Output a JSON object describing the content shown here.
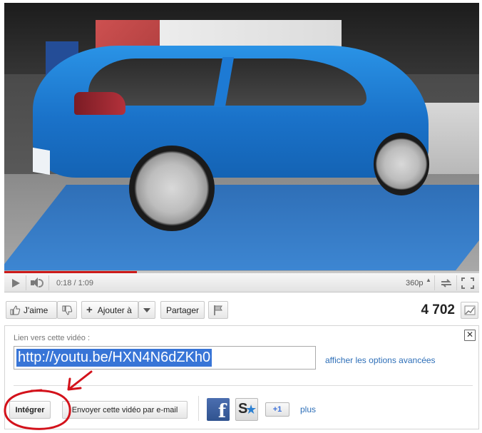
{
  "player": {
    "time_label": "0:18 / 1:09",
    "quality_label": "360p",
    "progress_fraction": 0.28
  },
  "actions": {
    "like_label": "J'aime",
    "add_label": "Ajouter à",
    "share_label": "Partager",
    "view_count": "4 702"
  },
  "share": {
    "link_title": "Lien vers cette vidéo :",
    "url": "http://youtu.be/HXN4N6dZKh0",
    "advanced_link": "afficher les options avancées",
    "close_label": "✕",
    "embed_label": "Intégrer",
    "email_label": "Envoyer cette vidéo par e-mail",
    "facebook_glyph": "f",
    "gplus_label": "+1",
    "more_label": "plus"
  },
  "colors": {
    "progress": "#cc1b1b",
    "link": "#2e6fb8",
    "selection": "#3875d7",
    "annotation": "#d3121b"
  }
}
